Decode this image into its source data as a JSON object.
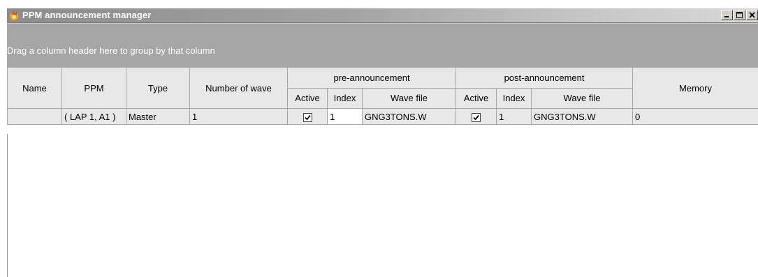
{
  "window": {
    "title": "PPM announcement manager",
    "controls": [
      "minimize",
      "maximize",
      "close"
    ]
  },
  "group_panel": {
    "hint": "Drag a column header here to group by that column"
  },
  "grid": {
    "headers": {
      "name": "Name",
      "ppm": "PPM",
      "type": "Type",
      "number_of_wave": "Number of wave",
      "pre_announcement": "pre-announcement",
      "post_announcement": "post-announcement",
      "memory": "Memory",
      "pre_sub": {
        "active": "Active",
        "index": "Index",
        "wave_file": "Wave file"
      },
      "post_sub": {
        "active": "Active",
        "index": "Index",
        "wave_file": "Wave file"
      }
    },
    "rows": [
      {
        "name": "",
        "ppm": "( LAP 1, A1 )",
        "type": "Master",
        "number_of_wave": "1",
        "pre_active": true,
        "pre_index": "1",
        "pre_wave_file": "GNG3TONS.W",
        "post_active": true,
        "post_index": "1",
        "post_wave_file": "GNG3TONS.W",
        "memory": "0"
      }
    ]
  },
  "colors": {
    "title_bar": "#8c8c8c",
    "group_panel": "#a6a6a6",
    "header_bg": "#e8e8e8",
    "grid_line": "#a9a9a9"
  }
}
